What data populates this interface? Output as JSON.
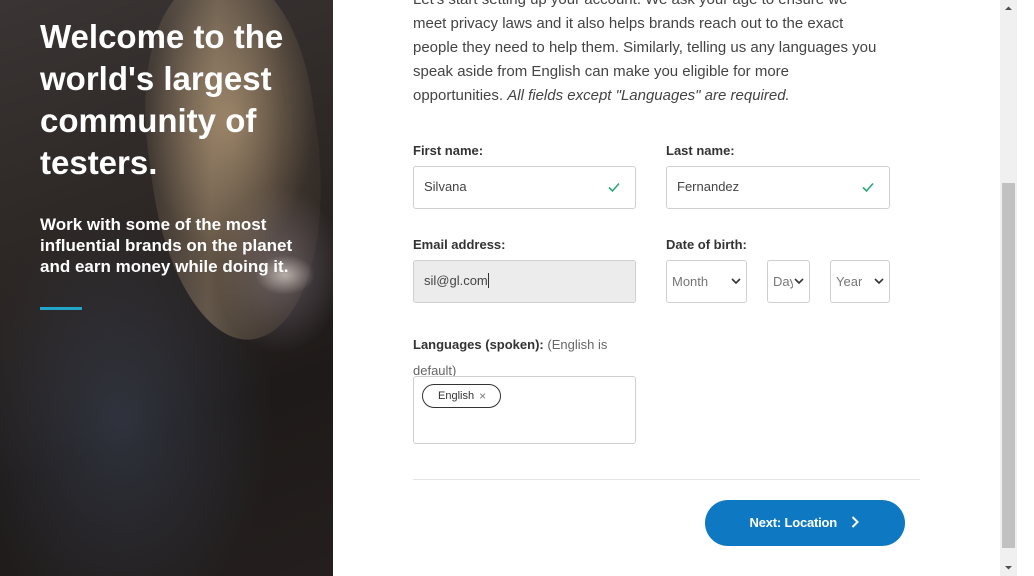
{
  "hero": {
    "title": "Welcome to the world's largest community of testers.",
    "subtitle": "Work with some of the most influential brands on the planet and earn money while doing it.",
    "accent_color": "#21a6c9"
  },
  "intro": {
    "line1": "Let's start setting up your account. We ask your age to ensure we",
    "line2": "meet privacy laws and it also helps brands reach out to the exact",
    "line3": "people they need to help them. Similarly, telling us any languages you",
    "line4": "speak aside from English can make you eligible for more",
    "line5_plain": "opportunities.",
    "line5_italic": "All fields except \"Languages\" are required."
  },
  "form": {
    "first_name": {
      "label": "First name:",
      "value": "Silvana",
      "status_icon": "check-icon"
    },
    "last_name": {
      "label": "Last name:",
      "value": "Fernandez",
      "status_icon": "check-icon"
    },
    "email": {
      "label": "Email address:",
      "value": "sil@gl.com"
    },
    "dob": {
      "label": "Date of birth:",
      "month": "Month",
      "day": "Day",
      "year": "Year"
    },
    "languages": {
      "label": "Languages (spoken):",
      "hint": "(English is",
      "hint2": "default)",
      "chips": [
        {
          "label": "English",
          "remove": "×"
        }
      ]
    }
  },
  "actions": {
    "next_label": "Next: Location",
    "next_color": "#0f78c2"
  },
  "colors": {
    "valid_check": "#2aa876"
  }
}
